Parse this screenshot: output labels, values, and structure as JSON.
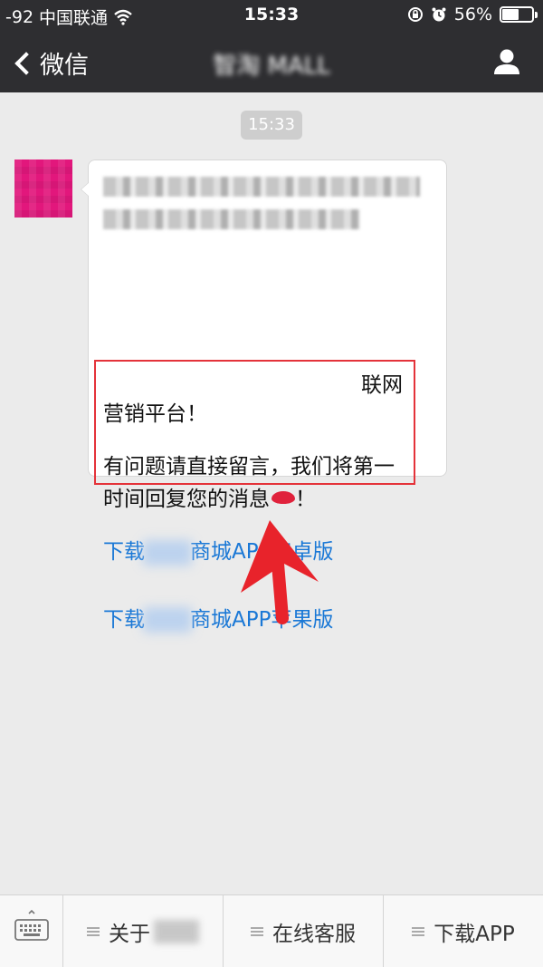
{
  "status_bar": {
    "signal": "-92",
    "carrier": "中国联通",
    "time": "15:33",
    "battery": "56%",
    "battery_level": 0.56
  },
  "nav": {
    "back_label": "微信",
    "title": "智淘 MALL"
  },
  "chat": {
    "timestamp": "15:33",
    "message": {
      "line1_tail": "联网",
      "line2": "营销平台！",
      "line3": "有问题请直接留言，我们将第一",
      "line4_text": "时间回复您的消息",
      "line4_end": "！"
    },
    "links": [
      {
        "prefix": "下载",
        "suffix": "商城APP安卓版"
      },
      {
        "prefix": "下载",
        "suffix": "商城APP苹果版"
      }
    ]
  },
  "toolbar": {
    "items": [
      {
        "label": "关于"
      },
      {
        "label": "在线客服"
      },
      {
        "label": "下载APP"
      }
    ]
  },
  "colors": {
    "bar_bg": "#2e2e31",
    "chat_bg": "#ebebeb",
    "link": "#1a78d6",
    "annotation": "#e4333a"
  }
}
